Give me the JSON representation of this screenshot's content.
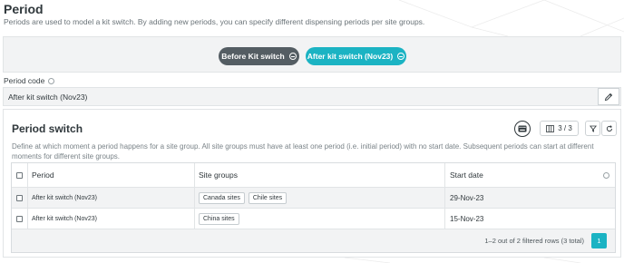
{
  "page": {
    "title": "Period",
    "description": "Periods are used to model a kit switch. By adding new periods, you can specify different dispensing periods per site groups."
  },
  "periods": {
    "tabs": [
      {
        "label": "Before Kit switch",
        "active": false
      },
      {
        "label": "After kit switch (Nov23)",
        "active": true
      }
    ]
  },
  "period_code": {
    "label": "Period code",
    "value": "After kit switch (Nov23)",
    "edit_icon": "pencil-icon"
  },
  "switch": {
    "title": "Period switch",
    "description": "Define at which moment a period happens for a site group. All site groups must have at least one period (i.e. initial period) with no start date. Subsequent periods can start at different moments for different site groups.",
    "columns_count": "3 / 3"
  },
  "table": {
    "headers": {
      "period": "Period",
      "site_groups": "Site groups",
      "start_date": "Start date"
    },
    "rows": [
      {
        "period": "After kit switch (Nov23)",
        "sites": [
          "Canada sites",
          "Chile sites"
        ],
        "start_date": "29-Nov-23"
      },
      {
        "period": "After kit switch (Nov23)",
        "sites": [
          "China sites"
        ],
        "start_date": "15-Nov-23"
      }
    ],
    "footer": {
      "summary": "1–2 out of 2 filtered rows (3 total)",
      "page": "1"
    }
  },
  "colors": {
    "accent": "#1bb3c3",
    "dark_pill": "#545d63",
    "panel_bg": "#f2f3f4"
  }
}
